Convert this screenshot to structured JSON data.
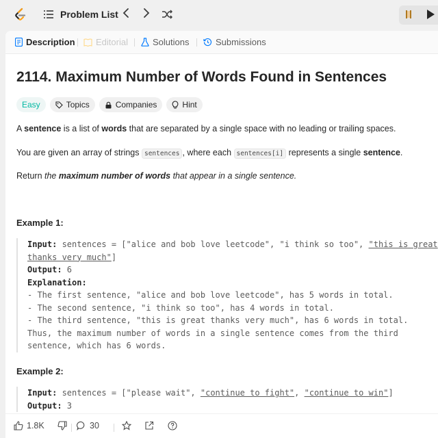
{
  "nav": {
    "problem_list_label": "Problem List",
    "prev_arrow": "‹",
    "next_arrow": "›"
  },
  "tabs": [
    {
      "label": "Description",
      "state": "active",
      "icon": "document-icon"
    },
    {
      "label": "Editorial",
      "state": "disabled",
      "icon": "book-icon"
    },
    {
      "label": "Solutions",
      "state": "normal",
      "icon": "flask-icon"
    },
    {
      "label": "Submissions",
      "state": "normal",
      "icon": "history-icon"
    }
  ],
  "problem": {
    "title": "2114. Maximum Number of Words Found in Sentences",
    "difficulty": "Easy",
    "tags": [
      "Topics",
      "Companies",
      "Hint"
    ],
    "para1": {
      "p1": "A ",
      "b1": "sentence",
      "p2": " is a list of ",
      "b2": "words",
      "p3": " that are separated by a single space with no leading or trailing spaces."
    },
    "para2": {
      "p1": "You are given an array of strings ",
      "c1": "sentences",
      "p2": ", where each ",
      "c2": "sentences[i]",
      "p3": " represents a single ",
      "b1": "sentence",
      "p4": "."
    },
    "para3": {
      "p1": "Return ",
      "i1": "the ",
      "b1": "maximum number of words",
      "i2": " that appear in a single sentence."
    }
  },
  "examples": [
    {
      "heading": "Example 1:",
      "input_label": "Input:",
      "input_a": " sentences = [\"alice and bob love leetcode\", \"i think so too\", ",
      "input_b": "\"this is great",
      "input_c": "thanks very much\"",
      "input_d": "]",
      "output_label": "Output:",
      "output_value": " 6",
      "explanation_label": "Explanation:",
      "explanation_lines": [
        "- The first sentence, \"alice and bob love leetcode\", has 5 words in total.",
        "- The second sentence, \"i think so too\", has 4 words in total.",
        "- The third sentence, \"this is great thanks very much\", has 6 words in total.",
        "Thus, the maximum number of words in a single sentence comes from the third",
        "sentence, which has 6 words."
      ]
    },
    {
      "heading": "Example 2:",
      "input_label": "Input:",
      "input_a": " sentences = [\"please wait\", ",
      "input_b": "\"continue to fight\"",
      "input_c": ", ",
      "input_d": "\"continue to win\"",
      "input_e": "]",
      "output_label": "Output:",
      "output_value": " 3"
    }
  ],
  "bottom": {
    "likes": "1.8K",
    "comments": "30"
  },
  "colors": {
    "easy": "#00b8a3",
    "accent_blue": "#007aff",
    "panel_bg": "#ffffff",
    "page_bg": "#f0f0f0"
  }
}
